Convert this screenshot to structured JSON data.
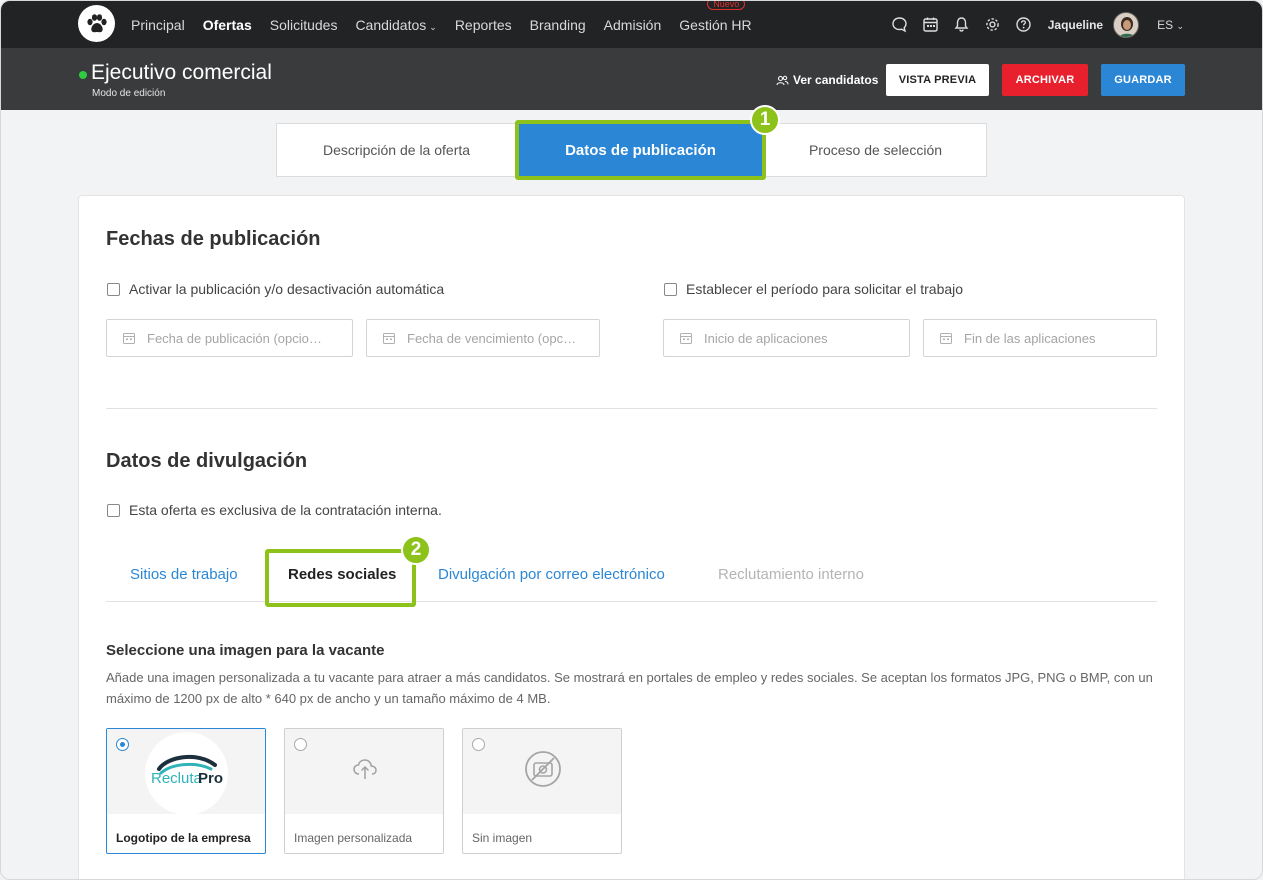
{
  "nav": {
    "items": [
      {
        "label": "Principal"
      },
      {
        "label": "Ofertas"
      },
      {
        "label": "Solicitudes"
      },
      {
        "label": "Candidatos"
      },
      {
        "label": "Reportes"
      },
      {
        "label": "Branding"
      },
      {
        "label": "Admisión"
      },
      {
        "label": "Gestión HR"
      }
    ],
    "new_badge": "Nuevo",
    "user_name": "Jaqueline",
    "language": "ES",
    "icons": [
      "chat-icon",
      "calendar-icon",
      "bell-icon",
      "gear-icon",
      "help-icon"
    ]
  },
  "header": {
    "job_title": "Ejecutivo comercial",
    "mode": "Modo de edición",
    "view_candidates": "Ver candidatos",
    "preview_button": "VISTA PREVIA",
    "archive_button": "ARCHIVAR",
    "save_button": "GUARDAR",
    "status_color": "#2ecc40"
  },
  "tabs": {
    "items": [
      {
        "label": "Descripción de la oferta"
      },
      {
        "label": "Datos de publicación",
        "active": true
      },
      {
        "label": "Proceso de selección"
      }
    ]
  },
  "callouts": {
    "one": "1",
    "two": "2",
    "color": "#8cc21a"
  },
  "dates": {
    "title": "Fechas de publicación",
    "auto_publish_label": "Activar la publicación y/o desactivación automática",
    "period_label": "Establecer el período para solicitar el trabajo",
    "publish_date_placeholder": "Fecha de publicación (opcio…",
    "expiry_date_placeholder": "Fecha de vencimiento (opc…",
    "apply_start_placeholder": "Inicio de aplicaciones",
    "apply_end_placeholder": "Fin de las aplicaciones"
  },
  "divulgation": {
    "title": "Datos de divulgación",
    "internal_only_label": "Esta oferta es exclusiva de la contratación interna.",
    "subtabs": [
      {
        "label": "Sitios de trabajo"
      },
      {
        "label": "Redes sociales",
        "active": true
      },
      {
        "label": "Divulgación por correo electrónico"
      },
      {
        "label": "Reclutamiento interno",
        "disabled": true
      }
    ]
  },
  "image_section": {
    "title": "Seleccione una imagen para la vacante",
    "description": "Añade una imagen personalizada a tu vacante para atraer a más candidatos. Se mostrará en portales de empleo y redes sociales. Se aceptan los formatos JPG, PNG o BMP, con un máximo de 1200 px de alto * 640 px de ancho y un tamaño máximo de 4 MB.",
    "options": [
      {
        "label": "Logotipo de la empresa",
        "selected": true,
        "logo_text_a": "Recluta",
        "logo_text_b": "Pro"
      },
      {
        "label": "Imagen personalizada",
        "selected": false
      },
      {
        "label": "Sin imagen",
        "selected": false
      }
    ]
  },
  "colors": {
    "primary": "#2b87d6",
    "danger": "#e8202e",
    "highlight": "#8cc21a"
  }
}
